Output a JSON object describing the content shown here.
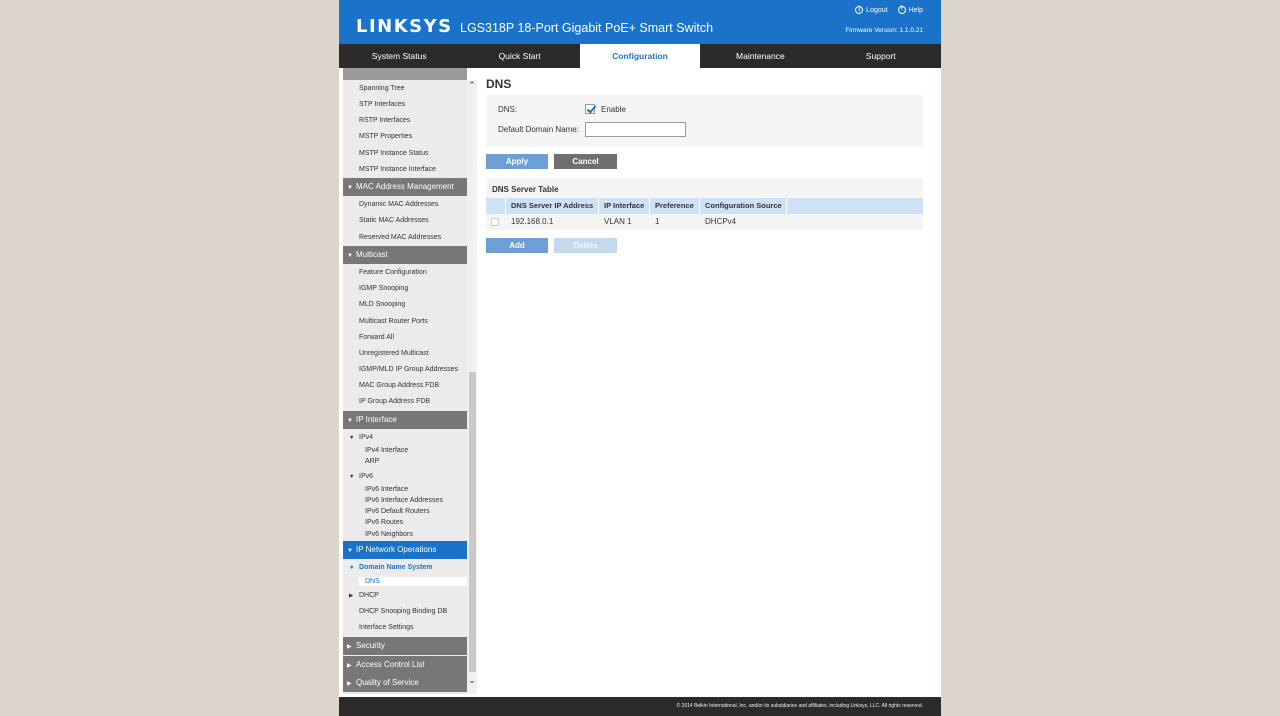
{
  "header": {
    "logo": "LINKSYS",
    "product": "LGS318P 18-Port Gigabit PoE+ Smart Switch",
    "logout_label": "Logout",
    "help_label": "Help",
    "firmware": "Firmware Version: 1.1.0.21"
  },
  "tabs": [
    "System Status",
    "Quick Start",
    "Configuration",
    "Maintenance",
    "Support"
  ],
  "active_tab": "Configuration",
  "sidebar": {
    "stp_items": [
      "Spanning Tree",
      "STP Interfaces",
      "RSTP Interfaces",
      "MSTP Properties",
      "MSTP Instance Status",
      "MSTP Instance Interface"
    ],
    "mac_header": "MAC Address Management",
    "mac_items": [
      "Dynamic MAC Addresses",
      "Static MAC Addresses",
      "Reserved MAC Addresses"
    ],
    "multicast_header": "Multicast",
    "multicast_items": [
      "Feature Configuration",
      "IGMP Snooping",
      "MLD Snooping",
      "Multicast Router Ports",
      "Forward All",
      "Unregistered Multicast",
      "IGMP/MLD IP Group Addresses",
      "MAC Group Address FDB",
      "IP Group Address FDB"
    ],
    "ip_interface_header": "IP Interface",
    "ipv4_label": "IPv4",
    "ipv4_items": [
      "IPv4 Interface",
      "ARP"
    ],
    "ipv6_label": "IPv6",
    "ipv6_items": [
      "IPv6 Interface",
      "IPv6 Interface Addresses",
      "IPv6 Default Routers",
      "IPv6 Routes",
      "IPv6 Neighbors"
    ],
    "ipnet_header": "IP Network Operations",
    "dns_group_label": "Domain Name System",
    "dns_item": "DNS",
    "dhcp_label": "DHCP",
    "ipnet_items": [
      "DHCP Snooping Binding DB",
      "Interface Settings"
    ],
    "security_header": "Security",
    "acl_header": "Access Control List",
    "qos_header": "Quality of Service"
  },
  "page": {
    "title": "DNS",
    "dns_label": "DNS:",
    "enable_label": "Enable",
    "dns_enabled": true,
    "domain_label": "Default Domain Name:",
    "domain_value": "",
    "apply_label": "Apply",
    "cancel_label": "Cancel"
  },
  "dns_table": {
    "title": "DNS Server Table",
    "columns": [
      "DNS Server IP Address",
      "IP Interface",
      "Preference",
      "Configuration Source"
    ],
    "rows": [
      {
        "ip": "192.168.0.1",
        "interface": "VLAN 1",
        "preference": "1",
        "source": "DHCPv4"
      }
    ],
    "add_label": "Add",
    "delete_label": "Delete"
  },
  "footer": "© 2014 Belkin International, Inc. and/or its subsidiaries and affiliates, including Linksys, LLC. All rights reserved.",
  "colors": {
    "brand_blue": "#1a73c9",
    "tab_bar": "#2b2b2b",
    "sidebar_header": "#777777",
    "button_blue": "#6d9fd4"
  }
}
